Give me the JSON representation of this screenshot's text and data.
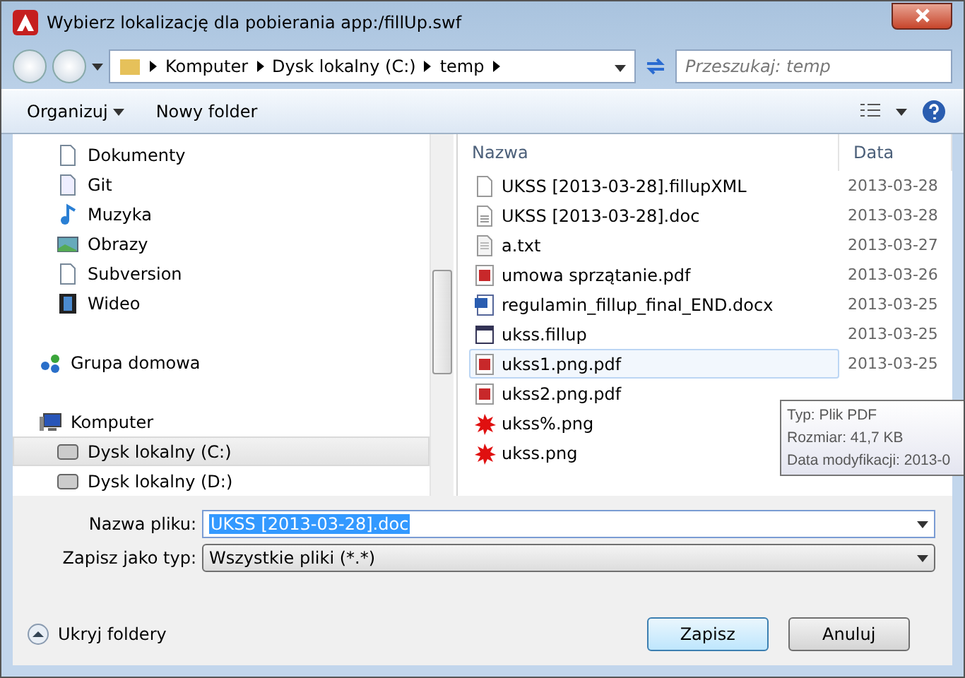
{
  "window": {
    "title": "Wybierz lokalizację dla pobierania app:/fillUp.swf"
  },
  "breadcrumb": [
    "Komputer",
    "Dysk lokalny (C:)",
    "temp"
  ],
  "search": {
    "placeholder": "Przeszukaj: temp"
  },
  "toolbar": {
    "organize": "Organizuj",
    "new_folder": "Nowy folder"
  },
  "sidebar": {
    "items": [
      {
        "label": "Dokumenty",
        "kind": "doc",
        "selected": false
      },
      {
        "label": "Git",
        "kind": "git",
        "selected": false
      },
      {
        "label": "Muzyka",
        "kind": "music",
        "selected": false
      },
      {
        "label": "Obrazy",
        "kind": "pictures",
        "selected": false
      },
      {
        "label": "Subversion",
        "kind": "doc",
        "selected": false
      },
      {
        "label": "Wideo",
        "kind": "video",
        "selected": false
      },
      {
        "label": "Grupa domowa",
        "kind": "homegroup",
        "selected": false
      },
      {
        "label": "Komputer",
        "kind": "computer",
        "selected": false
      },
      {
        "label": "Dysk lokalny (C:)",
        "kind": "drive",
        "selected": true
      },
      {
        "label": "Dysk lokalny (D:)",
        "kind": "drive",
        "selected": false
      }
    ]
  },
  "table": {
    "columns": [
      "Nazwa",
      "Data"
    ],
    "rows": [
      {
        "name": "UKSS [2013-03-28].fillupXML",
        "date": "2013-03-28",
        "kind": "file",
        "selected": false
      },
      {
        "name": "UKSS [2013-03-28].doc",
        "date": "2013-03-28",
        "kind": "doc",
        "selected": false
      },
      {
        "name": "a.txt",
        "date": "2013-03-27",
        "kind": "txt",
        "selected": false
      },
      {
        "name": "umowa sprzątanie.pdf",
        "date": "2013-03-26",
        "kind": "pdf",
        "selected": false
      },
      {
        "name": "regulamin_fillup_final_END.docx",
        "date": "2013-03-25",
        "kind": "word",
        "selected": false
      },
      {
        "name": "ukss.fillup",
        "date": "2013-03-25",
        "kind": "app",
        "selected": false
      },
      {
        "name": "ukss1.png.pdf",
        "date": "2013-03-25",
        "kind": "pdf",
        "selected": true
      },
      {
        "name": "ukss2.png.pdf",
        "kind": "pdf",
        "selected": false
      },
      {
        "name": "ukss%.png",
        "kind": "splat",
        "selected": false
      },
      {
        "name": "ukss.png",
        "kind": "splat",
        "selected": false
      }
    ]
  },
  "tooltip": [
    "Typ: Plik PDF",
    "Rozmiar: 41,7 KB",
    "Data modyfikacji: 2013-0"
  ],
  "filename": {
    "label": "Nazwa pliku:",
    "value": "UKSS [2013-03-28].doc"
  },
  "filetype": {
    "label": "Zapisz jako typ:",
    "value": "Wszystkie pliki (*.*)"
  },
  "hide_folders": "Ukryj foldery",
  "buttons": [
    "Zapisz",
    "Anuluj"
  ]
}
